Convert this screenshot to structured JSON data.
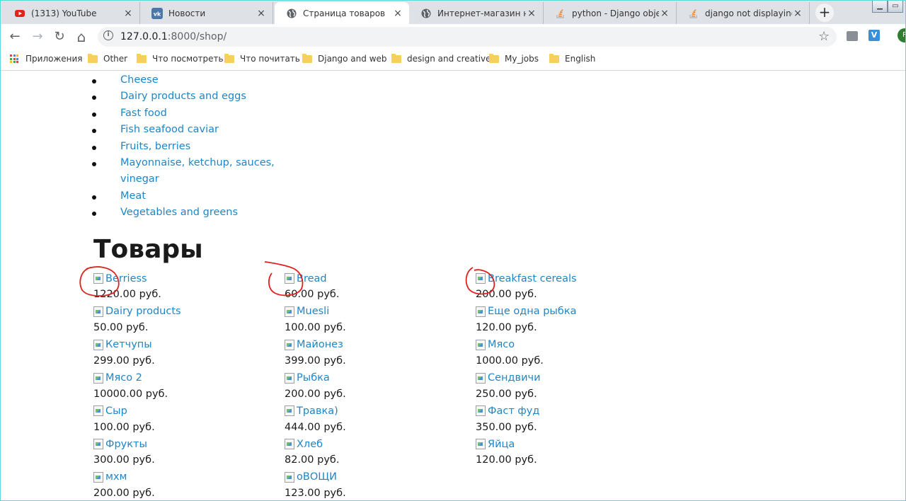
{
  "tabs": [
    {
      "title": "(1313) YouTube",
      "icon": "youtube-icon",
      "close": "×"
    },
    {
      "title": "Новости",
      "icon": "vk-icon",
      "close": "×"
    },
    {
      "title": "Страница товаров",
      "icon": "globe-icon",
      "close": "×",
      "active": true
    },
    {
      "title": "Интернет-магазин на D",
      "icon": "globe-icon",
      "close": "×"
    },
    {
      "title": "python - Django object.a",
      "icon": "stackoverflow-icon",
      "close": "×"
    },
    {
      "title": "django not displaying im",
      "icon": "stackoverflow-icon",
      "close": "×"
    }
  ],
  "new_tab": "+",
  "window_buttons": {
    "minimize": "▁",
    "maximize": "▭"
  },
  "toolbar": {
    "back": "←",
    "forward": "→",
    "reload": "↻",
    "home": "⌂",
    "info": "i",
    "url_host": "127.0.0.1",
    "url_path": ":8000/shop/",
    "star": "☆",
    "ext_v": "V",
    "profile_initial": "P"
  },
  "bookmarks": [
    {
      "label": "Приложения",
      "icon": "apps-icon"
    },
    {
      "label": "Other",
      "icon": "folder-icon"
    },
    {
      "label": "Что посмотреть",
      "icon": "folder-icon"
    },
    {
      "label": "Что почитать",
      "icon": "folder-icon"
    },
    {
      "label": "Django and web",
      "icon": "folder-icon"
    },
    {
      "label": "design and creative",
      "icon": "folder-icon"
    },
    {
      "label": "My_jobs",
      "icon": "folder-icon"
    },
    {
      "label": "English",
      "icon": "folder-icon"
    }
  ],
  "categories": [
    "Cheese",
    "Dairy products and eggs",
    "Fast food",
    "Fish seafood caviar",
    "Fruits, berries",
    "Mayonnaise, ketchup, sauces, vinegar",
    "Meat",
    "Vegetables and greens"
  ],
  "heading": "Товары",
  "products": [
    {
      "name": "Berriess",
      "price": "1220.00 руб."
    },
    {
      "name": "Bread",
      "price": "60.00 руб."
    },
    {
      "name": "Breakfast cereals",
      "price": "200.00 руб."
    },
    {
      "name": "Dairy products",
      "price": "50.00 руб."
    },
    {
      "name": "Muesli",
      "price": "100.00 руб."
    },
    {
      "name": "Еще одна рыбка",
      "price": "120.00 руб."
    },
    {
      "name": "Кетчупы",
      "price": "299.00 руб."
    },
    {
      "name": "Майонез",
      "price": "399.00 руб."
    },
    {
      "name": "Мясо",
      "price": "1000.00 руб."
    },
    {
      "name": "Мясо 2",
      "price": "10000.00 руб."
    },
    {
      "name": "Рыбка",
      "price": "200.00 руб."
    },
    {
      "name": "Сендвичи",
      "price": "250.00 руб."
    },
    {
      "name": "Сыр",
      "price": "100.00 руб."
    },
    {
      "name": "Травка)",
      "price": "444.00 руб."
    },
    {
      "name": "Фаст фуд",
      "price": "350.00 руб."
    },
    {
      "name": "Фрукты",
      "price": "300.00 руб."
    },
    {
      "name": "Хлеб",
      "price": "82.00 руб."
    },
    {
      "name": "Яйца",
      "price": "120.00 руб."
    },
    {
      "name": "мхм",
      "price": "200.00 руб."
    },
    {
      "name": "оВОЩИ",
      "price": "123.00 руб."
    }
  ],
  "annotation_color": "#e0201c",
  "link_color": "#1e86c7"
}
